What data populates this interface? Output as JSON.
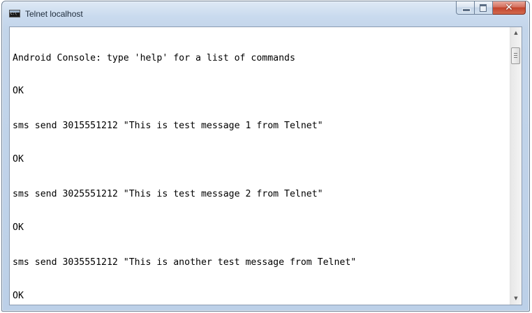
{
  "window": {
    "title": "Telnet localhost",
    "icon": "console-icon",
    "buttons": {
      "minimize": "minimize-icon",
      "maximize": "maximize-icon",
      "close": "close-icon",
      "close_glyph": "✕"
    }
  },
  "console": {
    "lines": [
      "Android Console: type 'help' for a list of commands",
      "OK",
      "sms send 3015551212 \"This is test message 1 from Telnet\"",
      "OK",
      "sms send 3025551212 \"This is test message 2 from Telnet\"",
      "OK",
      "sms send 3035551212 \"This is another test message from Telnet\"",
      "OK"
    ]
  },
  "scrollbar": {
    "up_arrow": "▲",
    "down_arrow": "▼"
  },
  "colors": {
    "close_button": "#c3442c",
    "frame": "#c3d5ea",
    "console_bg": "#ffffff",
    "console_text": "#000000"
  }
}
